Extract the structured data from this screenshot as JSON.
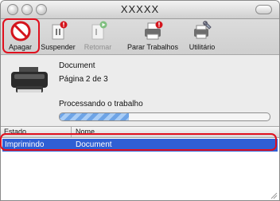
{
  "window": {
    "title": "XXXXX"
  },
  "toolbar": {
    "delete_label": "Apagar",
    "suspend_label": "Suspender",
    "resume_label": "Retomar",
    "stop_jobs_label": "Parar Trabalhos",
    "utility_label": "Utilitário"
  },
  "job": {
    "document_name": "Document",
    "page_status": "Página 2 de 3",
    "status_text": "Processando o trabalho",
    "progress_fraction": 0.33
  },
  "table": {
    "columns": [
      "Estado",
      "Nome"
    ],
    "rows": [
      {
        "state": "Imprimindo",
        "name": "Document"
      }
    ]
  },
  "colors": {
    "highlight_red": "#e0101e",
    "selection_blue": "#2f5fd4"
  }
}
